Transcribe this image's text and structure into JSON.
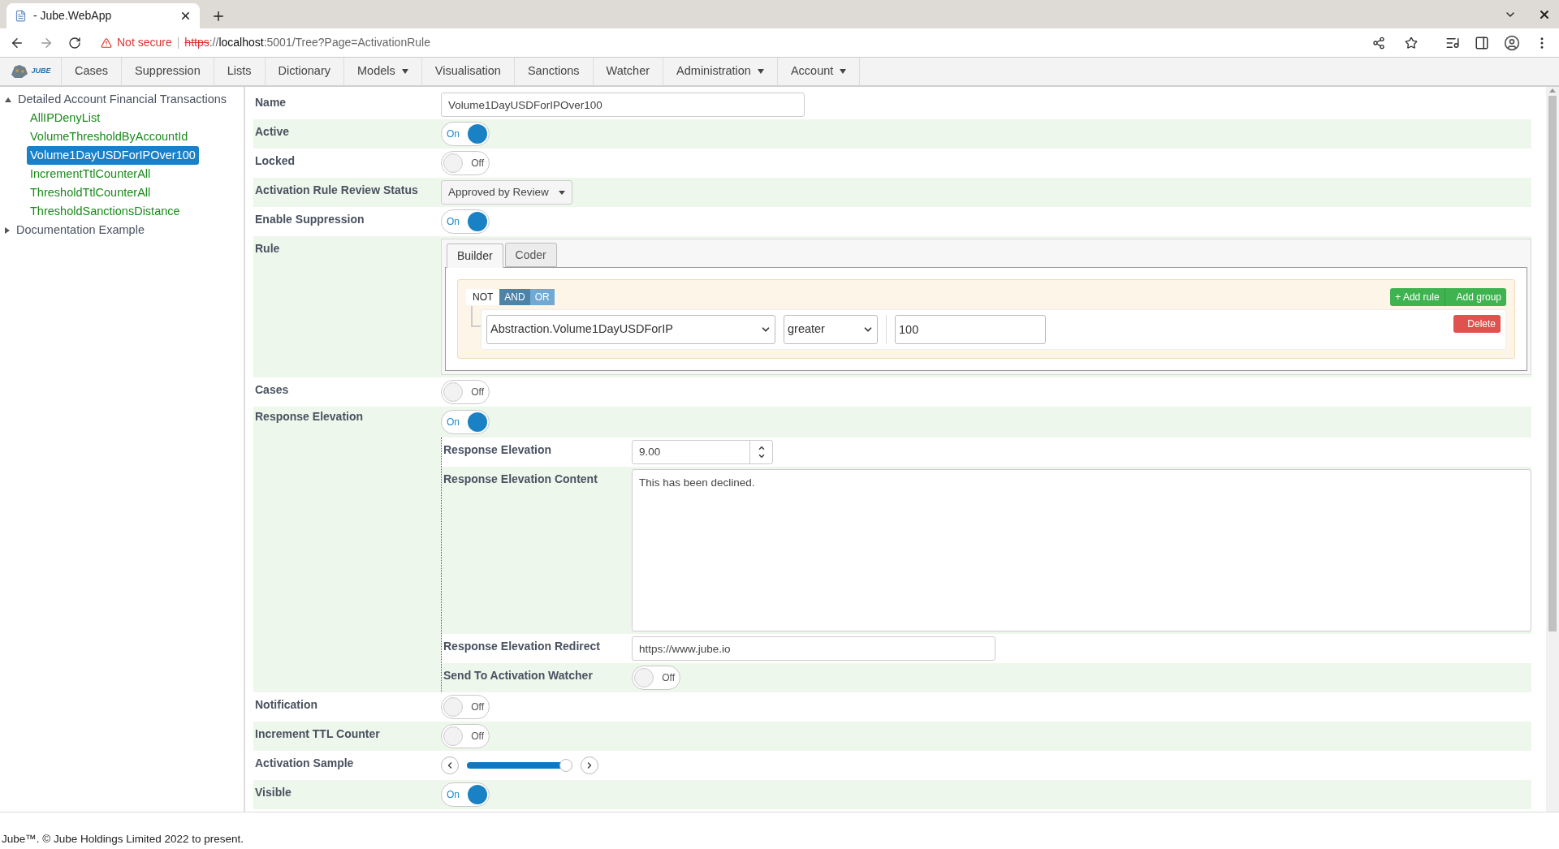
{
  "browser": {
    "tab_title": "- Jube.WebApp",
    "security": "Not secure",
    "security_divider": "|",
    "url_scheme": "https",
    "url_separator": "://",
    "url_host": "localhost",
    "url_path": ":5001/Tree?Page=ActivationRule"
  },
  "nav": {
    "logo_text": "JUBE",
    "items": [
      {
        "label": "Cases",
        "dropdown": false
      },
      {
        "label": "Suppression",
        "dropdown": false
      },
      {
        "label": "Lists",
        "dropdown": false
      },
      {
        "label": "Dictionary",
        "dropdown": false
      },
      {
        "label": "Models",
        "dropdown": true
      },
      {
        "label": "Visualisation",
        "dropdown": false
      },
      {
        "label": "Sanctions",
        "dropdown": false
      },
      {
        "label": "Watcher",
        "dropdown": false
      },
      {
        "label": "Administration",
        "dropdown": true
      },
      {
        "label": "Account",
        "dropdown": true
      }
    ]
  },
  "tree": [
    {
      "label": "Detailed Account Financial Transactions",
      "expanded": true,
      "children": [
        {
          "label": "AllIPDenyList",
          "selected": false
        },
        {
          "label": "VolumeThresholdByAccountId",
          "selected": false
        },
        {
          "label": "Volume1DayUSDForIPOver100",
          "selected": true
        },
        {
          "label": "IncrementTtlCounterAll",
          "selected": false
        },
        {
          "label": "ThresholdTtlCounterAll",
          "selected": false
        },
        {
          "label": "ThresholdSanctionsDistance",
          "selected": false
        }
      ]
    },
    {
      "label": "Documentation Example",
      "expanded": false
    }
  ],
  "form": {
    "rows": [
      {
        "kind": "text",
        "label": "Name",
        "value": "Volume1DayUSDForIPOver100"
      },
      {
        "kind": "toggle",
        "label": "Active",
        "on": true,
        "state_text": "On"
      },
      {
        "kind": "toggle",
        "label": "Locked",
        "on": false,
        "state_text": "Off"
      },
      {
        "kind": "select",
        "label": "Activation Rule Review Status",
        "value": "Approved by Review"
      },
      {
        "kind": "toggle",
        "label": "Enable Suppression",
        "on": true,
        "state_text": "On"
      },
      {
        "kind": "rule",
        "label": "Rule",
        "tabs": [
          {
            "label": "Builder",
            "selected": true
          },
          {
            "label": "Coder",
            "selected": false
          }
        ],
        "not_label": "NOT",
        "not_checked": false,
        "conjunctions": [
          {
            "label": "AND",
            "selected": true
          },
          {
            "label": "OR",
            "selected": false
          }
        ],
        "add_rule": "+ Add rule",
        "add_group": "Add group",
        "condition": {
          "field": "Abstraction.Volume1DayUSDForIP",
          "operator": "greater",
          "value": "100",
          "delete": "Delete"
        }
      },
      {
        "kind": "toggle",
        "label": "Cases",
        "on": false,
        "state_text": "Off"
      },
      {
        "kind": "group",
        "label": "Response Elevation",
        "on": true,
        "state_text": "On",
        "children": [
          {
            "kind": "number",
            "label": "Response Elevation",
            "value": "9.00"
          },
          {
            "kind": "textarea",
            "label": "Response Elevation Content",
            "value": "This has been declined."
          },
          {
            "kind": "text",
            "label": "Response Elevation Redirect",
            "value": "https://www.jube.io"
          },
          {
            "kind": "toggle",
            "label": "Send To Activation Watcher",
            "on": false,
            "state_text": "Off"
          }
        ]
      },
      {
        "kind": "toggle",
        "label": "Notification",
        "on": false,
        "state_text": "Off"
      },
      {
        "kind": "toggle",
        "label": "Increment TTL Counter",
        "on": false,
        "state_text": "Off"
      },
      {
        "kind": "slider",
        "label": "Activation Sample",
        "level": 0.94
      },
      {
        "kind": "toggle",
        "label": "Visible",
        "on": true,
        "state_text": "On"
      }
    ]
  },
  "footer": "Jube™. © Jube Holdings Limited 2022 to present."
}
